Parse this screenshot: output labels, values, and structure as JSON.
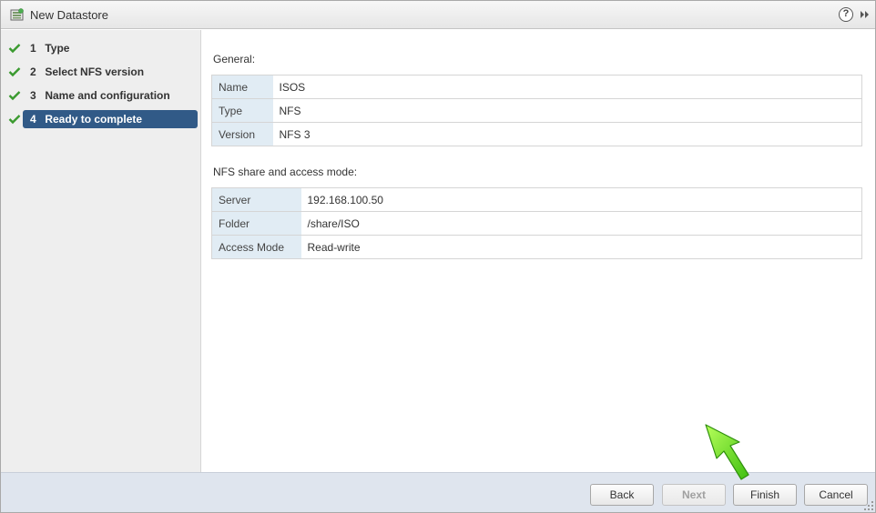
{
  "window": {
    "title": "New Datastore",
    "icon": "datastore-icon",
    "help_label": "?",
    "expand_icon": "double-chevron-right-icon"
  },
  "steps": [
    {
      "number": "1",
      "label": "Type",
      "completed": true,
      "active": false
    },
    {
      "number": "2",
      "label": "Select NFS version",
      "completed": true,
      "active": false
    },
    {
      "number": "3",
      "label": "Name and configuration",
      "completed": true,
      "active": false
    },
    {
      "number": "4",
      "label": "Ready to complete",
      "completed": true,
      "active": true
    }
  ],
  "general": {
    "title": "General:",
    "rows": [
      {
        "key": "Name",
        "value": "ISOS"
      },
      {
        "key": "Type",
        "value": "NFS"
      },
      {
        "key": "Version",
        "value": "NFS 3"
      }
    ]
  },
  "nfs": {
    "title": "NFS share and access mode:",
    "rows": [
      {
        "key": "Server",
        "value": "192.168.100.50"
      },
      {
        "key": "Folder",
        "value": "/share/ISO"
      },
      {
        "key": "Access Mode",
        "value": "Read-write"
      }
    ]
  },
  "footer": {
    "back_label": "Back",
    "next_label": "Next",
    "finish_label": "Finish",
    "cancel_label": "Cancel"
  },
  "colors": {
    "active_step": "#315a87",
    "check": "#3a9a2f",
    "key_cell": "#e1ecf4",
    "footer": "#dfe5ee",
    "pointer_arrow": "#66dd22"
  }
}
